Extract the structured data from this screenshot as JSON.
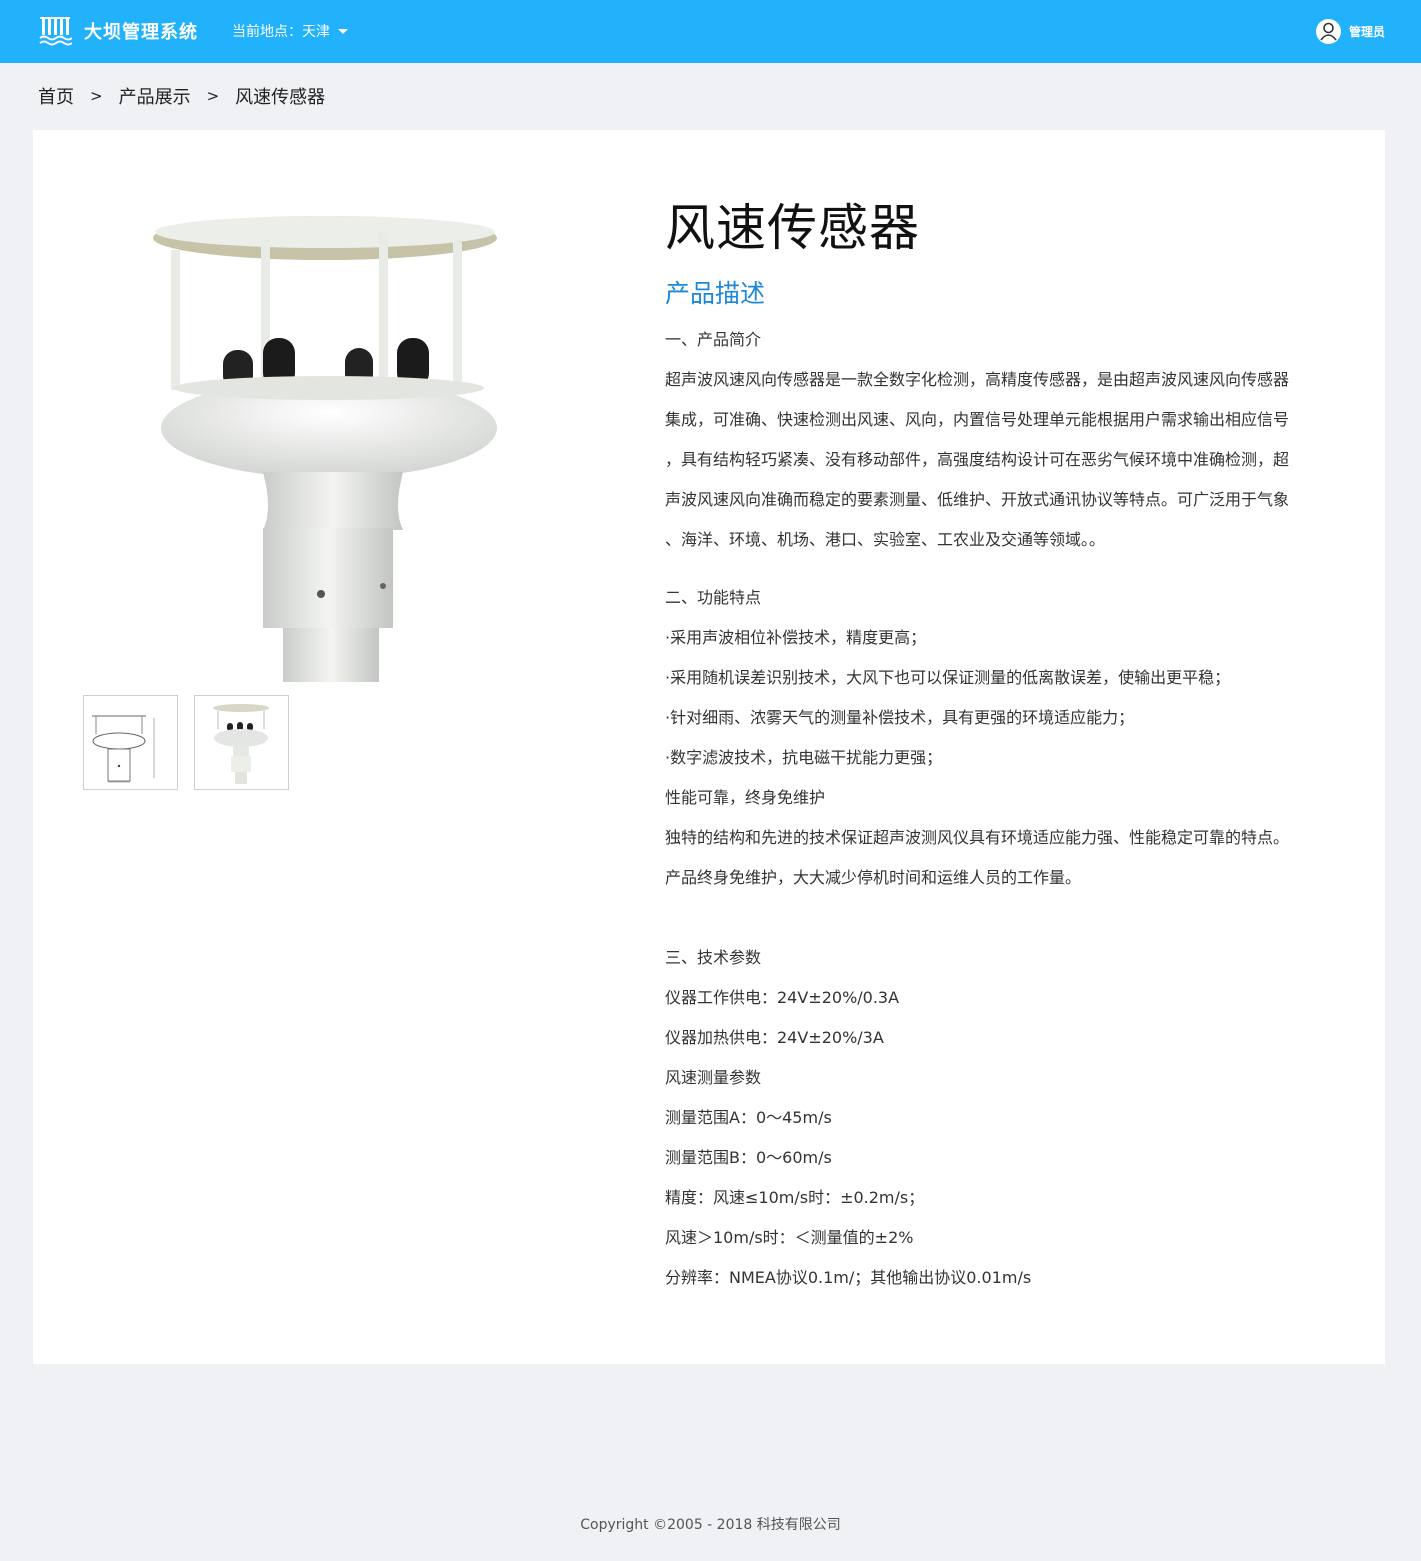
{
  "header": {
    "app_title": "大坝管理系统",
    "location_label": "当前地点：天津",
    "user_name": "管理员",
    "logo_icon": "dam-icon",
    "user_icon": "user-icon",
    "bg_color": "#22b1fb"
  },
  "breadcrumb": {
    "items": [
      "首页",
      "产品展示",
      "风速传感器"
    ],
    "separator": ">"
  },
  "product": {
    "title": "风速传感器",
    "section_title": "产品描述",
    "intro_heading": "一、产品简介",
    "intro_lines": [
      "超声波风速风向传感器是一款全数字化检测，高精度传感器，是由超声波风速风向传感器",
      "集成，可准确、快速检测出风速、风向，内置信号处理单元能根据用户需求输出相应信号",
      "，具有结构轻巧紧凑、没有移动部件，高强度结构设计可在恶劣气候环境中准确检测，超",
      "声波风速风向准确而稳定的要素测量、低维护、开放式通讯协议等特点。可广泛用于气象",
      "、海洋、环境、机场、港口、实验室、工农业及交通等领域。。"
    ],
    "features_heading": "二、功能特点",
    "features_lines": [
      "·采用声波相位补偿技术，精度更高；",
      "·采用随机误差识别技术，大风下也可以保证测量的低离散误差，使输出更平稳；",
      "·针对细雨、浓雾天气的测量补偿技术，具有更强的环境适应能力；",
      "·数字滤波技术，抗电磁干扰能力更强；",
      "性能可靠，终身免维护",
      "独特的结构和先进的技术保证超声波测风仪具有环境适应能力强、性能稳定可靠的特点。",
      "产品终身免维护，大大减少停机时间和运维人员的工作量。"
    ],
    "specs_heading": "三、技术参数",
    "specs_lines": [
      "仪器工作供电：24V±20%/0.3A",
      "仪器加热供电：24V±20%/3A",
      "风速测量参数",
      "测量范围A：0～45m/s",
      "测量范围B：0～60m/s",
      "精度：风速≤10m/s时：±0.2m/s；",
      "风速＞10m/s时：＜测量值的±2%",
      "分辨率：NMEA协议0.1m/；其他输出协议0.01m/s"
    ],
    "accent_color": "#1e88d8"
  },
  "footer": {
    "copyright": "Copyright ©2005 - 2018  科技有限公司"
  }
}
